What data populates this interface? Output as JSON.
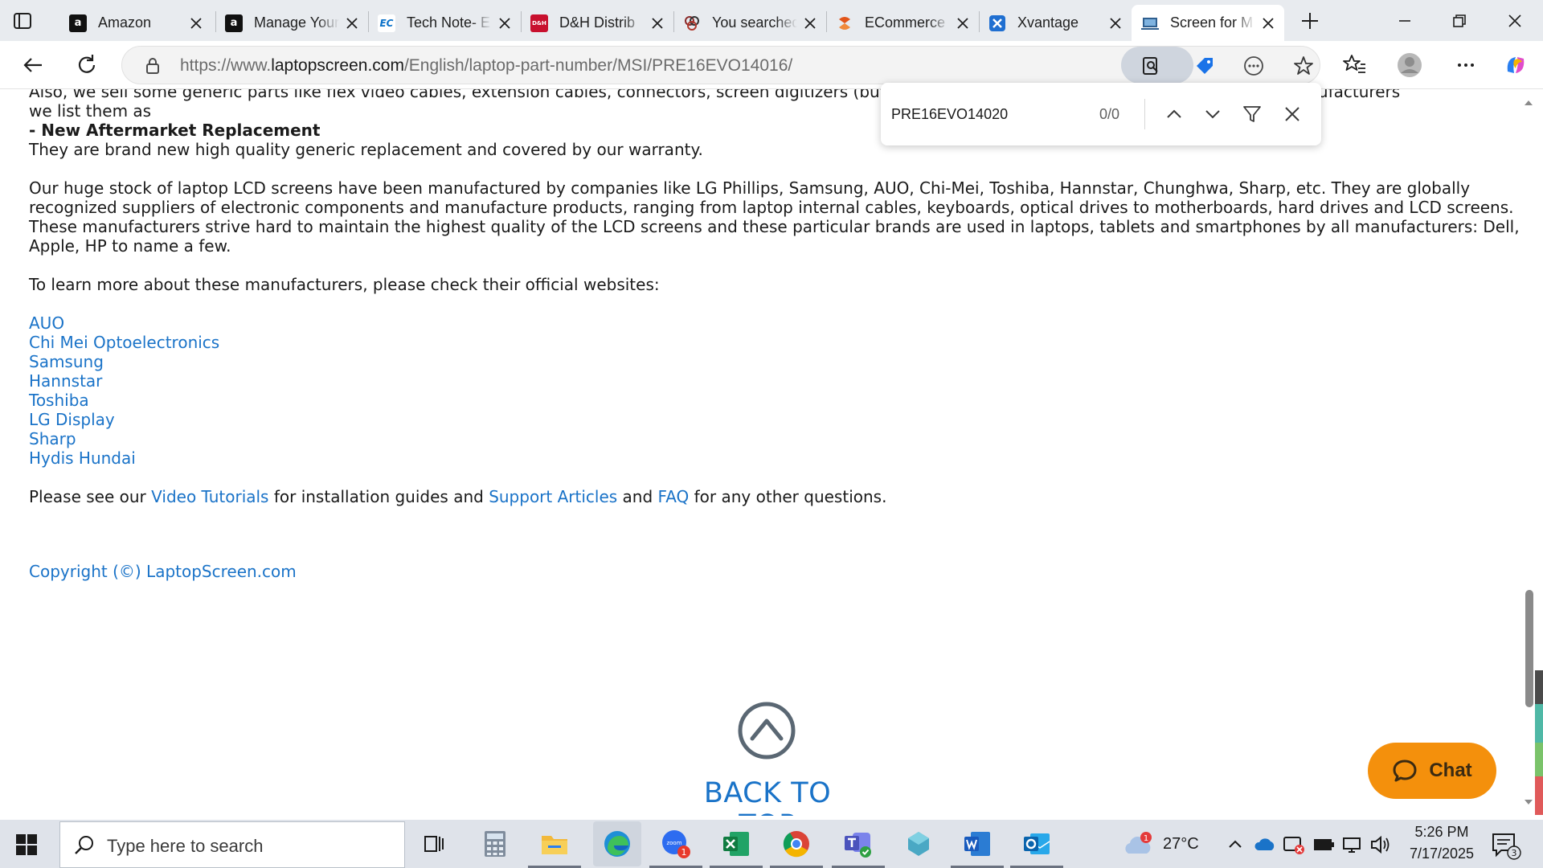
{
  "browser": {
    "tabs": [
      {
        "title": "Amazon",
        "favicon": "amazon-icon",
        "color": "#1a1a1a",
        "glyph": "a"
      },
      {
        "title": "Manage Your",
        "favicon": "amazon-icon",
        "color": "#1a1a1a",
        "glyph": "a"
      },
      {
        "title": "Tech Note- E",
        "favicon": "ec-icon",
        "color": "#0b72c9",
        "glyph": "EC"
      },
      {
        "title": "D&H Distrib",
        "favicon": "dh-icon",
        "color": "#c8102e",
        "glyph": "D&H"
      },
      {
        "title": "You searched",
        "favicon": "search-people-icon",
        "color": "#7a2a2a",
        "glyph": "∞"
      },
      {
        "title": "ECommerce",
        "favicon": "ecommerce-icon",
        "color": "#e2551a",
        "glyph": "S"
      },
      {
        "title": "Xvantage",
        "favicon": "xvantage-icon",
        "color": "#1f6fd1",
        "glyph": "X"
      },
      {
        "title": "Screen for M",
        "favicon": "laptopscreen-icon",
        "color": "#2f5f8f",
        "glyph": "▭",
        "active": true
      }
    ],
    "url_prefix": "https://www.",
    "url_host": "laptopscreen.com",
    "url_path": "/English/laptop-part-number/MSI/PRE16EVO14016/"
  },
  "find_bar": {
    "query": "PRE16EVO14020",
    "count": "0/0"
  },
  "page": {
    "partial_line_1": "Also, we sell some generic parts like flex video cables, extension cables, connectors, screen digitizers (but n",
    "partial_line_1_tail": "arty manufacturers",
    "partial_line_2": "we list them as",
    "aftermarket_heading": "- New Aftermarket Replacement",
    "aftermarket_text": "They are brand new high quality generic replacement and covered by our warranty.",
    "stock_paragraph": [
      "Our huge stock of laptop LCD screens have been manufactured by companies like LG Phillips, Samsung, AUO, Chi-Mei, Toshiba, Hannstar, Chunghwa, Sharp, etc. They are globally",
      "recognized suppliers of electronic components and manufacture products, ranging from laptop internal cables, keyboards, optical drives to motherboards, hard drives and LCD screens.",
      "These manufacturers strive hard to maintain the highest quality of the LCD screens and these particular brands are used in laptops, tablets and smartphones by all manufacturers: Dell,",
      "Apple, HP to name a few."
    ],
    "learn_more": "To learn more about these manufacturers, please check their official websites:",
    "manufacturers": [
      "AUO",
      "Chi Mei Optoelectronics",
      "Samsung",
      "Hannstar",
      "Toshiba",
      "LG Display",
      "Sharp",
      "Hydis Hundai"
    ],
    "see_our": "Please see our ",
    "video_tutorials": "Video Tutorials",
    "for_install": " for installation guides and ",
    "support_articles": "Support Articles",
    "and": " and ",
    "faq": "FAQ",
    "other_q": " for any other questions.",
    "copyright": "Copyright (©) LaptopScreen.com",
    "back_to_top": "BACK TO TOP",
    "chat_label": "Chat"
  },
  "taskbar": {
    "search_placeholder": "Type here to search",
    "apps": [
      "task-view-icon",
      "calculator-icon",
      "file-explorer-icon",
      "edge-icon",
      "zoom-icon",
      "excel-icon",
      "chrome-icon",
      "teams-icon",
      "app-icon",
      "word-icon",
      "outlook-icon"
    ],
    "zoom_badge": "1",
    "weather_badge": "1",
    "temperature": "27°C",
    "time": "5:26 PM",
    "date": "7/17/2025",
    "notification_count": "3"
  }
}
